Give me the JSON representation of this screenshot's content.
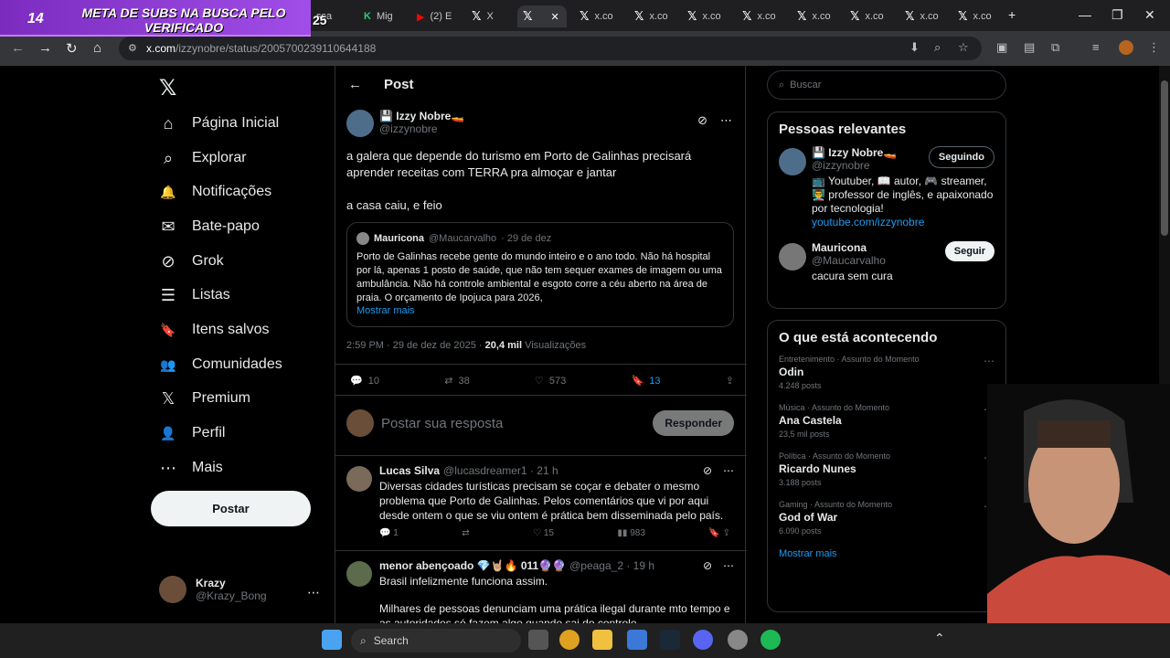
{
  "overlay": {
    "count": "14",
    "text": "META DE SUBS NA BUSCA PELO VERIFICADO",
    "goal": "25"
  },
  "browser": {
    "tabs": [
      {
        "label": "ssa"
      },
      {
        "label": "Mig"
      },
      {
        "label": "(2) E"
      },
      {
        "label": "X"
      },
      {
        "label": ""
      },
      {
        "label": "x.co"
      },
      {
        "label": "x.co"
      },
      {
        "label": "x.co"
      },
      {
        "label": "x.co"
      },
      {
        "label": "x.co"
      },
      {
        "label": "x.co"
      },
      {
        "label": "x.co"
      },
      {
        "label": "x.co"
      }
    ],
    "url_host": "x.com",
    "url_path": "/izzynobre/status/2005700239110644188"
  },
  "nav": {
    "items": [
      {
        "label": "Página Inicial",
        "icon": "home-icon",
        "glyph": "⌂"
      },
      {
        "label": "Explorar",
        "icon": "search-icon",
        "glyph": "⌕"
      },
      {
        "label": "Notificações",
        "icon": "bell-icon",
        "glyph": "🔔"
      },
      {
        "label": "Bate-papo",
        "icon": "mail-icon",
        "glyph": "✉"
      },
      {
        "label": "Grok",
        "icon": "grok-icon",
        "glyph": "⊘"
      },
      {
        "label": "Listas",
        "icon": "list-icon",
        "glyph": "☰"
      },
      {
        "label": "Itens salvos",
        "icon": "bookmark-icon",
        "glyph": "🔖"
      },
      {
        "label": "Comunidades",
        "icon": "people-icon",
        "glyph": "👥"
      },
      {
        "label": "Premium",
        "icon": "x-icon",
        "glyph": "𝕏"
      },
      {
        "label": "Perfil",
        "icon": "profile-icon",
        "glyph": "👤"
      },
      {
        "label": "Mais",
        "icon": "more-icon",
        "glyph": "⋯"
      }
    ],
    "post_button": "Postar",
    "account": {
      "name": "Krazy",
      "handle": "@Krazy_Bong"
    }
  },
  "post": {
    "header": "Post",
    "author_name": "💾 Izzy Nobre🚤",
    "author_handle": "@izzynobre",
    "body_line1": "a galera que depende do turismo em Porto de Galinhas precisará aprender receitas com TERRA pra almoçar e jantar",
    "body_line2": "a casa caiu, e feio",
    "quote": {
      "name": "Mauricona",
      "handle": "@Maucarvalho",
      "date": "· 29 de dez",
      "text": "Porto de Galinhas recebe gente do mundo inteiro e o ano todo. Não há hospital por lá, apenas 1 posto de saúde, que não tem sequer exames de imagem ou uma ambulância. Não há controle ambiental e esgoto corre a céu aberto na área de praia. O orçamento de Ipojuca para 2026,",
      "more": "Mostrar mais"
    },
    "time": "2:59 PM · 29 de dez de 2025 ·",
    "views_count": "20,4 mil",
    "views_label": "Visualizações",
    "stats": {
      "replies": "10",
      "reposts": "38",
      "likes": "573",
      "bookmarks": "13"
    },
    "reply_placeholder": "Postar sua resposta",
    "reply_button": "Responder"
  },
  "comments": [
    {
      "name": "Lucas Silva",
      "handle": "@lucasdreamer1 · 21 h",
      "text": "Diversas cidades turísticas precisam se coçar e debater o mesmo problema que Porto de Galinhas. Pelos comentários que vi por aqui desde ontem o que se viu ontem é prática bem disseminada pelo país.",
      "replies": "1",
      "reposts": "",
      "likes": "15",
      "views": "983"
    },
    {
      "name": "menor abençoado 💎🤘🏼🔥 011🔮🔮",
      "handle": "@peaga_2 · 19 h",
      "text1": "Brasil infelizmente funciona assim.",
      "text2": "Milhares de pessoas denunciam uma prática ilegal durante mto tempo e as autoridades só fazem algo quando sai do controle"
    }
  ],
  "sidebar": {
    "search_placeholder": "Buscar",
    "relevant_title": "Pessoas relevantes",
    "people": [
      {
        "name": "💾 Izzy Nobre🚤",
        "handle": "@izzynobre",
        "bio": "📺 Youtuber, 📖 autor, 🎮 streamer, 👨‍🏫 professor de inglês, e apaixonado por tecnologia!",
        "link": "youtube.com/izzynobre",
        "button": "Seguindo"
      },
      {
        "name": "Mauricona",
        "handle": "@Maucarvalho",
        "bio": "cacura sem cura",
        "button": "Seguir"
      }
    ],
    "trends_title": "O que está acontecendo",
    "trends": [
      {
        "category": "Entretenimento · Assunto do Momento",
        "name": "Odin",
        "count": "4.248 posts"
      },
      {
        "category": "Música · Assunto do Momento",
        "name": "Ana Castela",
        "count": "23,5 mil posts"
      },
      {
        "category": "Política · Assunto do Momento",
        "name": "Ricardo Nunes",
        "count": "3.188 posts"
      },
      {
        "category": "Gaming · Assunto do Momento",
        "name": "God of War",
        "count": "6.090 posts"
      }
    ],
    "trends_more": "Mostrar mais"
  },
  "taskbar": {
    "search_label": "Search"
  }
}
